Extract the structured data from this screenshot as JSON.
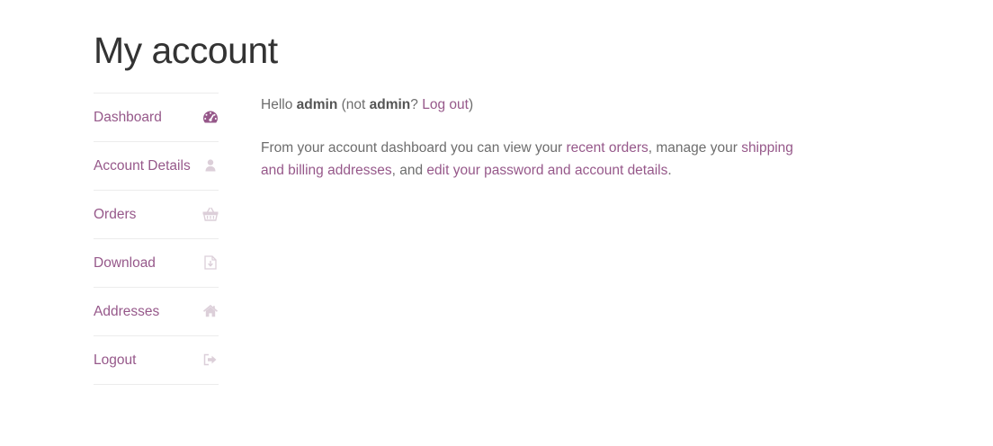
{
  "page_title": "My account",
  "colors": {
    "link": "#96588a",
    "text": "#6d6d6d",
    "icon_active": "#96588a",
    "icon_muted": "#dccfd9"
  },
  "sidebar": {
    "items": [
      {
        "label": "Dashboard",
        "icon": "dashboard-gauge-icon",
        "active": true
      },
      {
        "label": "Account Details",
        "icon": "user-icon",
        "active": false
      },
      {
        "label": "Orders",
        "icon": "shopping-basket-icon",
        "active": false
      },
      {
        "label": "Download",
        "icon": "file-download-icon",
        "active": false
      },
      {
        "label": "Addresses",
        "icon": "home-icon",
        "active": false
      },
      {
        "label": "Logout",
        "icon": "sign-out-icon",
        "active": false
      }
    ]
  },
  "content": {
    "hello_prefix": "Hello ",
    "username": "admin",
    "not_prefix": " (not ",
    "not_username": "admin",
    "question": "? ",
    "logout_link": "Log out",
    "close_paren": ")",
    "dashboard_text_1": "From your account dashboard you can view your ",
    "recent_orders_link": "recent orders",
    "dashboard_text_2": ", manage your ",
    "addresses_link": "shipping and billing addresses",
    "dashboard_text_3": ", and ",
    "account_details_link": "edit your password and account details",
    "dashboard_text_4": "."
  }
}
